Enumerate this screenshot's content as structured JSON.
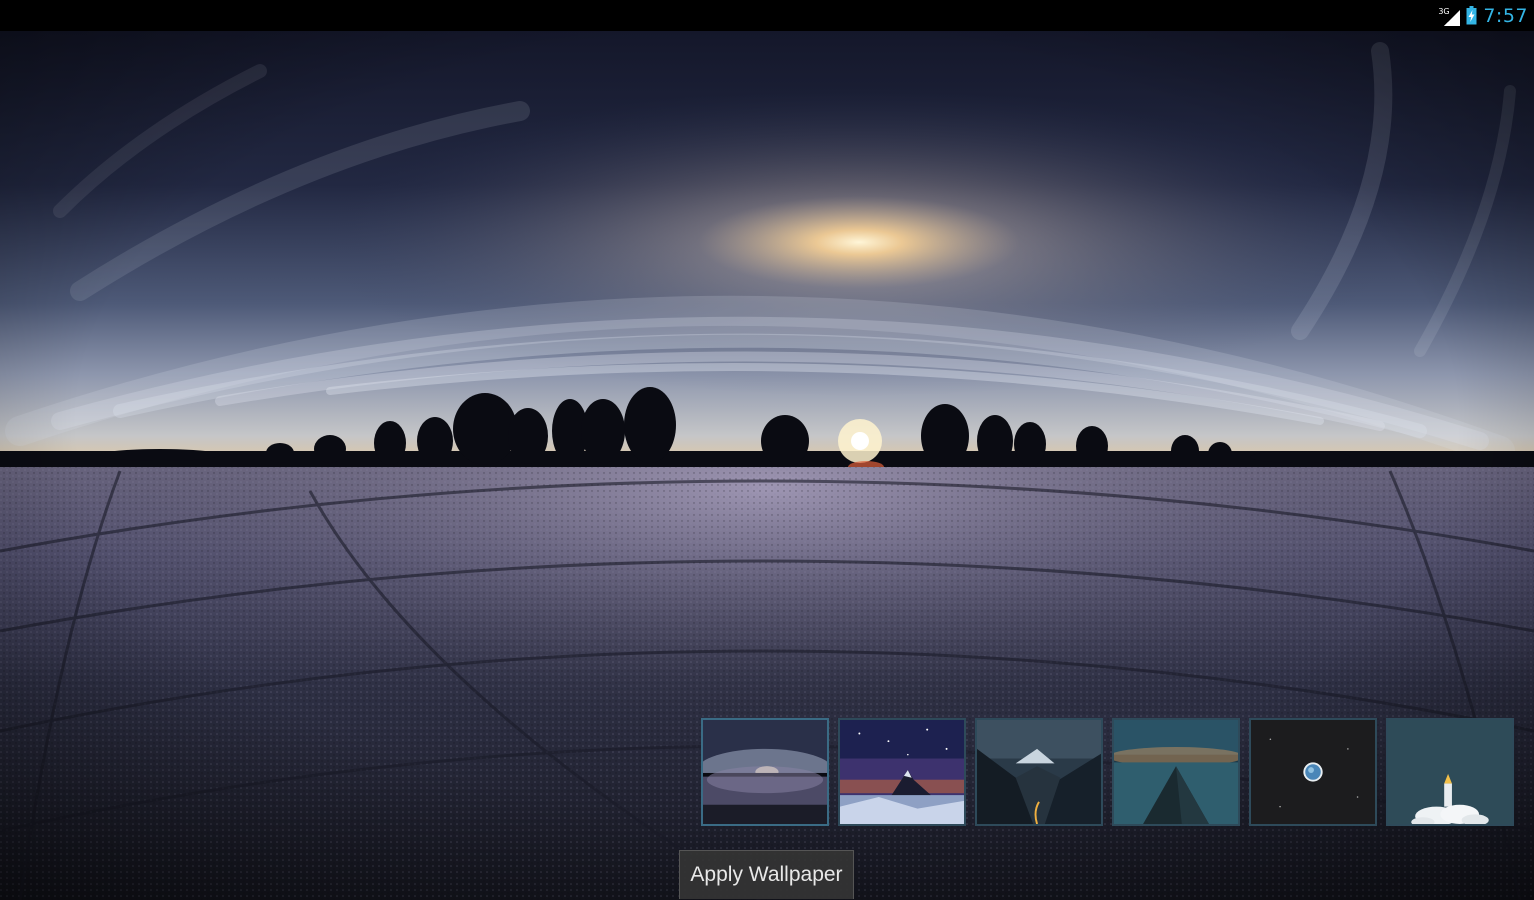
{
  "status_bar": {
    "network_type": "3G",
    "time": "7:57",
    "signal_icon": "signal-bars-icon",
    "battery_icon": "battery-charging-icon",
    "clock_color": "#33b5e5"
  },
  "wallpaper_preview": {
    "description_icon": "frosted-field-sunset-wallpaper"
  },
  "thumbnails": [
    {
      "name": "thumbnail-frosted-field-sunset",
      "selected": true
    },
    {
      "name": "thumbnail-mountain-starry-night",
      "selected": false
    },
    {
      "name": "thumbnail-mountain-valley",
      "selected": false
    },
    {
      "name": "thumbnail-pyramid-sea",
      "selected": false
    },
    {
      "name": "thumbnail-planet-space",
      "selected": false
    },
    {
      "name": "thumbnail-rocket-launch",
      "selected": false
    }
  ],
  "apply_button": {
    "label": "Apply Wallpaper"
  },
  "colors": {
    "status_bar_bg": "#000000",
    "thumb_border": "#2e4a5a",
    "button_bg": "#343434"
  }
}
